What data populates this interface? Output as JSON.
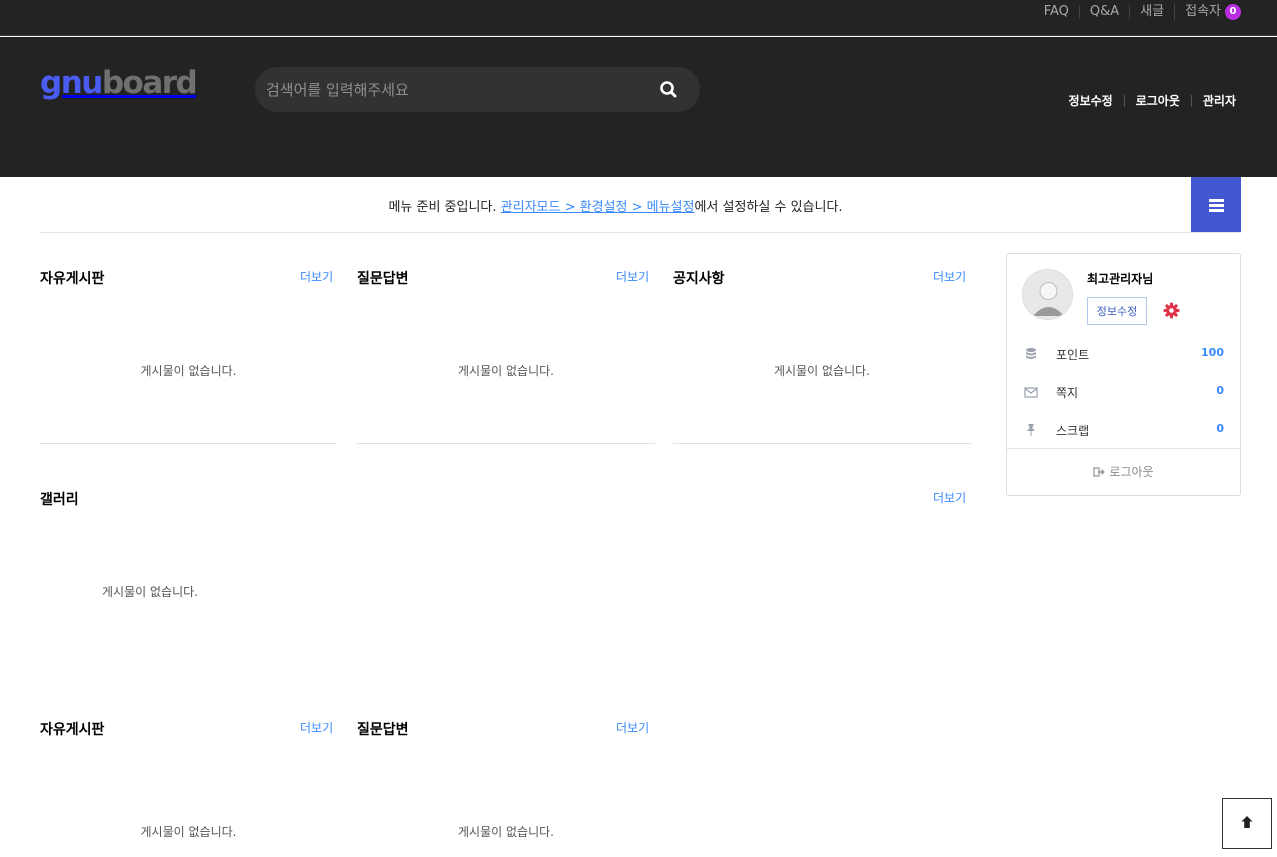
{
  "topbar": {
    "links": [
      "FAQ",
      "Q&A",
      "새글",
      "접속자"
    ],
    "visitor_count": "0"
  },
  "header": {
    "logo_part1": "gnu",
    "logo_part2": "board",
    "search_placeholder": "검색어를 입력해주세요",
    "links": [
      "정보수정",
      "로그아웃",
      "관리자"
    ]
  },
  "gnb": {
    "message_prefix": "메뉴 준비 중입니다. ",
    "message_link": "관리자모드 > 환경설정 > 메뉴설정",
    "message_suffix": "에서 설정하실 수 있습니다."
  },
  "boards": [
    {
      "title": "자유게시판",
      "more": "더보기",
      "empty": "게시물이 없습니다."
    },
    {
      "title": "질문답변",
      "more": "더보기",
      "empty": "게시물이 없습니다."
    },
    {
      "title": "공지사항",
      "more": "더보기",
      "empty": "게시물이 없습니다."
    },
    {
      "title": "갤러리",
      "more": "더보기",
      "empty": "게시물이 없습니다."
    },
    {
      "title": "자유게시판",
      "more": "더보기",
      "empty": "게시물이 없습니다."
    },
    {
      "title": "질문답변",
      "more": "더보기",
      "empty": "게시물이 없습니다."
    }
  ],
  "profile": {
    "name": "최고관리자님",
    "edit_label": "정보수정",
    "rows": [
      {
        "label": "포인트",
        "value": "100",
        "icon": "database-icon"
      },
      {
        "label": "쪽지",
        "value": "0",
        "icon": "envelope-icon"
      },
      {
        "label": "스크랩",
        "value": "0",
        "icon": "pin-icon"
      }
    ],
    "logout_label": "로그아웃"
  },
  "colors": {
    "header_bg": "#232323",
    "accent": "#4158d1",
    "link": "#3a8afd",
    "badge": "#b92ee2",
    "gear": "#e0344b"
  }
}
